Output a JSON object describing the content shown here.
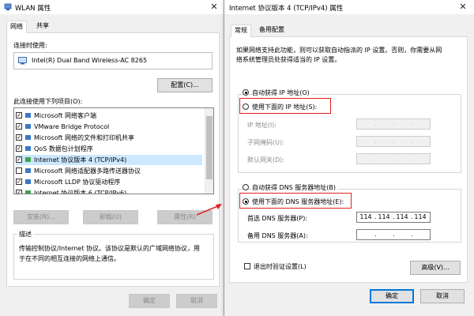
{
  "wlan_window": {
    "title": "WLAN 属性",
    "tabs": [
      "网络",
      "共享"
    ],
    "connect_using_label": "连接时使用:",
    "adapter_name": "Intel(R) Dual Band Wireless-AC 8265",
    "configure_button": "配置(C)...",
    "items_label": "此连接使用下列项目(O):",
    "items": [
      {
        "label": "Microsoft 网络客户端",
        "checked": true
      },
      {
        "label": "VMware Bridge Protocol",
        "checked": true
      },
      {
        "label": "Microsoft 网络的文件和打印机共享",
        "checked": true
      },
      {
        "label": "QoS 数据包计划程序",
        "checked": true
      },
      {
        "label": "Internet 协议版本 4 (TCP/IPv4)",
        "checked": true
      },
      {
        "label": "Microsoft 网络适配器多路传送器协议",
        "checked": false
      },
      {
        "label": "Microsoft LLDP 协议驱动程序",
        "checked": true
      },
      {
        "label": "Internet 协议版本 6 (TCP/IPv6)",
        "checked": true
      }
    ],
    "install_button": "安装(N)...",
    "uninstall_button": "卸载(U)",
    "properties_button": "属性(R)",
    "description_label": "描述",
    "description_text_1": "传输控制协议/Internet 协议。该协议是默认的广域网络协议，用",
    "description_text_2": "于在不同的相互连接的网络上通信。",
    "ok_button": "确定",
    "cancel_button": "取消"
  },
  "ipv4_window": {
    "title": "Internet 协议版本 4 (TCP/IPv4) 属性",
    "tabs": [
      "常规",
      "备用配置"
    ],
    "intro_1": "如果网络支持此功能，则可以获取自动指派的 IP 设置。否则，你需要从网",
    "intro_2": "络系统管理员处获得适当的 IP 设置。",
    "auto_ip_label": "自动获得 IP 地址(O)",
    "manual_ip_label": "使用下面的 IP 地址(S):",
    "ip_address_label": "IP 地址(I):",
    "subnet_label": "子网掩码(U):",
    "gateway_label": "默认网关(D):",
    "auto_dns_label": "自动获得 DNS 服务器地址(B)",
    "manual_dns_label": "使用下面的 DNS 服务器地址(E):",
    "preferred_dns_label": "首选 DNS 服务器(P):",
    "preferred_dns_value": [
      "114",
      "114",
      "114",
      "114"
    ],
    "alternate_dns_label": "备用 DNS 服务器(A):",
    "validate_label": "退出时验证设置(L)",
    "advanced_button": "高级(V)...",
    "ok_button": "确定",
    "cancel_button": "取消",
    "ip_mode": "auto",
    "dns_mode": "manual"
  },
  "colors": {
    "highlight": "#e02020",
    "accent": "#0078d7",
    "arrow": "#e02020"
  }
}
